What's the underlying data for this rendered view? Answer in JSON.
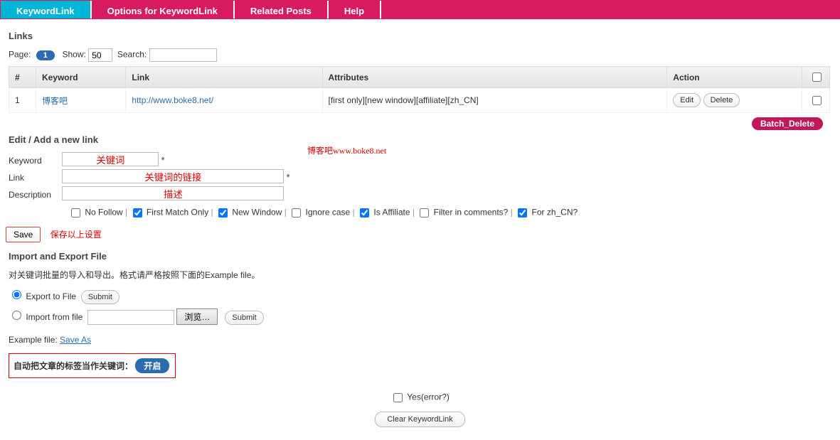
{
  "tabs": {
    "keywordlink": "KeywordLink",
    "options": "Options for KeywordLink",
    "related": "Related Posts",
    "help": "Help"
  },
  "links": {
    "heading": "Links",
    "page_label": "Page:",
    "page_current": "1",
    "show_label": "Show:",
    "show_value": "50",
    "search_label": "Search:",
    "cols": {
      "num": "#",
      "keyword": "Keyword",
      "link": "Link",
      "attributes": "Attributes",
      "action": "Action"
    },
    "rows": [
      {
        "num": "1",
        "keyword": "博客吧",
        "link": "http://www.boke8.net/",
        "attributes": "[first only][new window][affiliate][zh_CN]",
        "edit": "Edit",
        "delete": "Delete"
      }
    ],
    "batch_delete": "Batch_Delete"
  },
  "watermark": "博客吧www.boke8.net",
  "edit": {
    "heading": "Edit / Add a new link",
    "keyword_label": "Keyword",
    "keyword_value": "关键词",
    "link_label": "Link",
    "link_value": "关键词的链接",
    "desc_label": "Description",
    "desc_value": "描述",
    "star": "*",
    "checks": {
      "nofollow": "No Follow",
      "firstmatch": "First Match Only",
      "newwindow": "New Window",
      "ignorecase": "Ignore case",
      "affiliate": "Is Affiliate",
      "filtercomments": "Filter in comments?",
      "forzh": "For zh_CN?"
    },
    "save": "Save",
    "save_note": "保存以上设置"
  },
  "io": {
    "heading": "Import and Export File",
    "note": "对关键词批量的导入和导出。格式请严格按照下面的Example file。",
    "export_label": "Export to File",
    "import_label": "Import from file",
    "submit": "Submit",
    "browse": "浏览…",
    "example_label": "Example file:",
    "example_link": "Save As"
  },
  "autotag": {
    "label": "自动把文章的标签当作关键词：",
    "btn": "开启"
  },
  "footer": {
    "yeserror": "Yes(error?)",
    "clear": "Clear KeywordLink"
  }
}
